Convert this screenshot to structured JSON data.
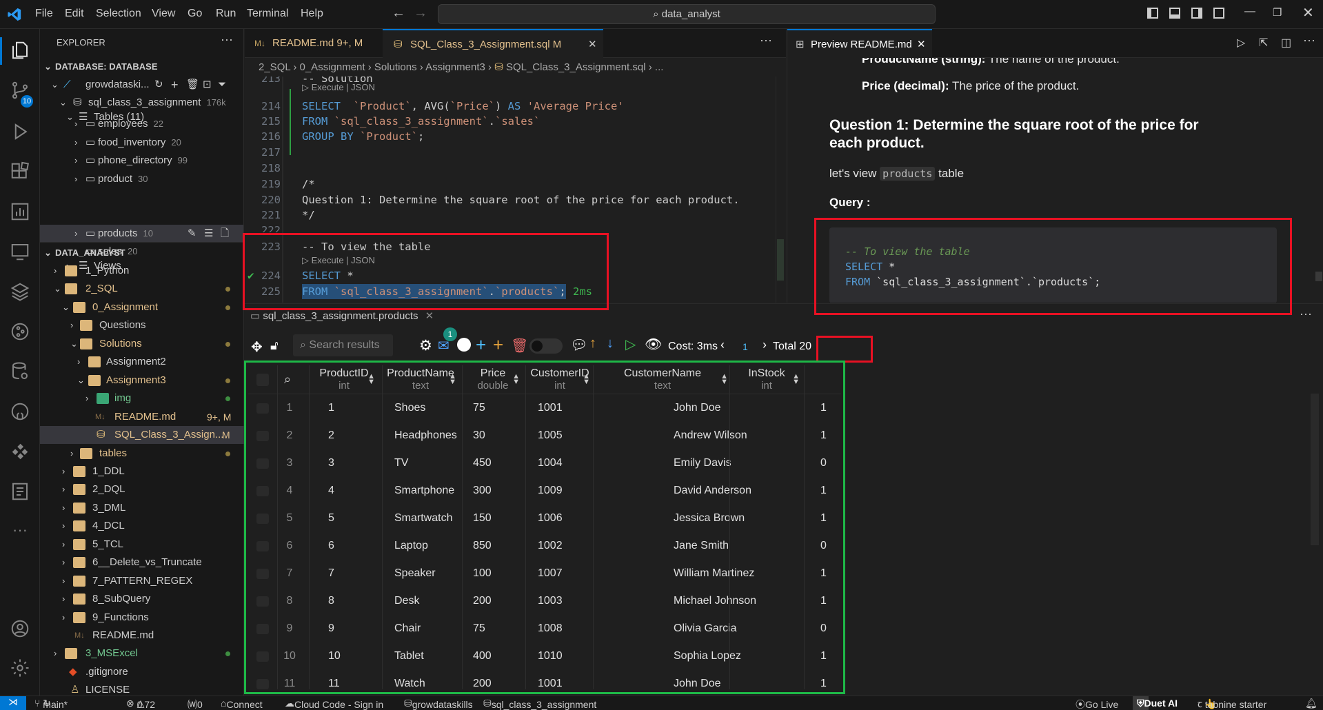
{
  "menu": [
    "File",
    "Edit",
    "Selection",
    "View",
    "Go",
    "Run",
    "Terminal",
    "Help"
  ],
  "search_text": "data_analyst",
  "sidebar": {
    "title": "EXPLORER",
    "db_section": "DATABASE: DATABASE",
    "connection": "growdataski...",
    "database": "sql_class_3_assignment",
    "database_size": "176k",
    "tables_label": "Tables",
    "tables_count": "(11)",
    "tables": [
      {
        "name": "employees",
        "count": "22"
      },
      {
        "name": "food_inventory",
        "count": "20"
      },
      {
        "name": "phone_directory",
        "count": "99"
      },
      {
        "name": "product",
        "count": "30"
      },
      {
        "name": "products",
        "count": "10"
      },
      {
        "name": "sales",
        "count": "20"
      }
    ],
    "views_label": "Views",
    "workspace": "DATA_ANALYST",
    "files": {
      "python": "1_Python",
      "sql": "2_SQL",
      "assignment": "0_Assignment",
      "questions": "Questions",
      "solutions": "Solutions",
      "assignment2": "Assignment2",
      "assignment3": "Assignment3",
      "img": "img",
      "readme": "README.md",
      "readme_badge": "9+, M",
      "sqlfile": "SQL_Class_3_Assign...",
      "sqlfile_badge": "M",
      "tables": "tables",
      "ddl": "1_DDL",
      "dql": "2_DQL",
      "dml": "3_DML",
      "dcl": "4_DCL",
      "tcl": "5_TCL",
      "delete": "6__Delete_vs_Truncate",
      "pattern": "7_PATTERN_REGEX",
      "subquery": "8_SubQuery",
      "functions": "9_Functions",
      "readme2": "README.md",
      "msexcel": "3_MSExcel",
      "gitignore": ".gitignore",
      "license": "LICENSE"
    }
  },
  "tabs": {
    "readme": "README.md",
    "readme_badge": "9+, M",
    "sql": "SQL_Class_3_Assignment.sql",
    "sql_badge": "M",
    "preview": "Preview README.md"
  },
  "breadcrumb": [
    "2_SQL",
    "0_Assignment",
    "Solutions",
    "Assignment3",
    "SQL_Class_3_Assignment.sql",
    "..."
  ],
  "code": {
    "lens": "Execute | JSON",
    "lines": [
      {
        "n": "213",
        "t": "-- Solution"
      },
      {
        "n": "214",
        "t": "SELECT  `Product`, AVG(`Price`) AS 'Average Price'"
      },
      {
        "n": "215",
        "t": "FROM `sql_class_3_assignment`.`sales`"
      },
      {
        "n": "216",
        "t": "GROUP BY `Product`;"
      },
      {
        "n": "217",
        "t": ""
      },
      {
        "n": "218",
        "t": ""
      },
      {
        "n": "219",
        "t": "/*"
      },
      {
        "n": "220",
        "t": "Question 1: Determine the square root of the price for each product."
      },
      {
        "n": "221",
        "t": "*/"
      },
      {
        "n": "222",
        "t": ""
      },
      {
        "n": "223",
        "t": "-- To view the table"
      },
      {
        "n": "224",
        "t": "SELECT *"
      },
      {
        "n": "225",
        "t": "FROM `sql_class_3_assignment`.`products`;"
      }
    ],
    "exec_time": "2ms"
  },
  "preview": {
    "line1_bold": "ProductName (string):",
    "line1_rest": " The name of the product.",
    "line2_bold": "Price (decimal):",
    "line2_rest": " The price of the product.",
    "heading": "Question 1: Determine the square root of the price for each product.",
    "lets_view": "let's view",
    "inline_code": "products",
    "table_word": "table",
    "query_label": "Query :",
    "code1": "-- To view the table",
    "code2_kw": "SELECT",
    "code2_rest": " *",
    "code3_kw": "FROM",
    "code3_rest": " `sql_class_3_assignment`.`products`;"
  },
  "panel": {
    "tab": "sql_class_3_assignment.products",
    "search_placeholder": "Search results",
    "badge": "1",
    "cost": "Cost: 3ms",
    "page": "1",
    "total": "Total 20"
  },
  "table": {
    "columns": [
      {
        "name": "ProductID",
        "type": "int"
      },
      {
        "name": "ProductName",
        "type": "text"
      },
      {
        "name": "Price",
        "type": "double"
      },
      {
        "name": "CustomerID",
        "type": "int"
      },
      {
        "name": "CustomerName",
        "type": "text"
      },
      {
        "name": "InStock",
        "type": "int"
      }
    ],
    "rows": [
      [
        "1",
        "1",
        "Shoes",
        "75",
        "1001",
        "John Doe",
        "1"
      ],
      [
        "2",
        "2",
        "Headphones",
        "30",
        "1005",
        "Andrew Wilson",
        "1"
      ],
      [
        "3",
        "3",
        "TV",
        "450",
        "1004",
        "Emily Davis",
        "0"
      ],
      [
        "4",
        "4",
        "Smartphone",
        "300",
        "1009",
        "David Anderson",
        "1"
      ],
      [
        "5",
        "5",
        "Smartwatch",
        "150",
        "1006",
        "Jessica Brown",
        "1"
      ],
      [
        "6",
        "6",
        "Laptop",
        "850",
        "1002",
        "Jane Smith",
        "0"
      ],
      [
        "7",
        "7",
        "Speaker",
        "100",
        "1007",
        "William Martinez",
        "1"
      ],
      [
        "8",
        "8",
        "Desk",
        "200",
        "1003",
        "Michael Johnson",
        "1"
      ],
      [
        "9",
        "9",
        "Chair",
        "75",
        "1008",
        "Olivia Garcia",
        "0"
      ],
      [
        "10",
        "10",
        "Tablet",
        "400",
        "1010",
        "Sophia Lopez",
        "1"
      ],
      [
        "11",
        "11",
        "Watch",
        "200",
        "1001",
        "John Doe",
        "1"
      ]
    ]
  },
  "status": {
    "branch": "main*",
    "problems": "0",
    "warnings": "72",
    "ports": "0",
    "connect": "Connect",
    "cloud": "Cloud Code - Sign in",
    "conn": "growdataskills",
    "db": "sql_class_3_assignment",
    "golive": "Go Live",
    "duet": "Duet AI",
    "tabnine": "tabnine starter"
  },
  "colors": {
    "annotation_red": "#e81123",
    "annotation_green": "#1eb847",
    "accent": "#0078d4"
  }
}
